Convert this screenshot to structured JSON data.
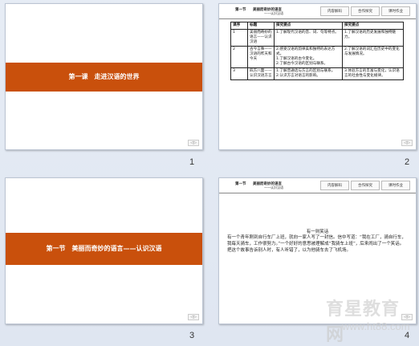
{
  "slides": [
    {
      "number": "1",
      "title": "第一课　走进汉语的世界",
      "corner": "◁▷"
    },
    {
      "number": "2",
      "header": {
        "section": "第一节",
        "title": "美丽而奇妙的语言",
        "subtitle": "——认识汉语",
        "buttons": [
          "内容解码",
          "合作探究",
          "课时作业"
        ]
      },
      "table": {
        "headers": [
          "课序",
          "标题",
          "探究要点",
          "探究要点"
        ],
        "rows": [
          {
            "id": "1",
            "title": "美丽而奇妙的语言——认识汉语",
            "c3": "1.了解现代汉语的音、词、句等特点。",
            "c4": "1.了解汉语的历史发展和独特魅力。"
          },
          {
            "id": "2",
            "title": "古今言殊——汉语的昨天和今天",
            "c3": "2.感受汉语的韵律美和独特的表达方式。\n1.了解汉语的古今变化。\n2.了解古今汉语的区别与联系。",
            "c4": "2.了解汉语的词汇在历史中的变化与发展情况。"
          },
          {
            "id": "3",
            "title": "四方八面——认识汉语方言",
            "c3": "1.了解普通话与方言的区别与联系。\n2.认识方言对语言的影响。",
            "c4": "3.体验方言的丰富与变化，认识语言的社会性与变化规律。"
          }
        ]
      },
      "corner": "◁▷"
    },
    {
      "number": "3",
      "title": "第一节　美丽而奇妙的语言——认识汉语",
      "corner": "◁▷"
    },
    {
      "number": "4",
      "header": {
        "section": "第一节",
        "title": "美丽而奇妙的语言",
        "subtitle": "——认识汉语",
        "buttons": [
          "内容解码",
          "合作探究",
          "课时作业"
        ]
      },
      "story_title": "有一则笑话",
      "story_body": "有一个青年刚到自行车厂上班，就向一家人写了一封信。信中写道：“我在工厂，骑自行车，我每天骑车，工作很努力。”一个好好的意思被理解成“我骑车上班”，后来闹出了一个笑话。把这个故事告诉别人时，有人听错了，以为他骑车去了飞机场。",
      "corner": "◁▷"
    }
  ],
  "watermark": {
    "brand": "育星教育网",
    "url": "www.ht88.com"
  },
  "colors": {
    "accent_bar": "#c9500c"
  }
}
